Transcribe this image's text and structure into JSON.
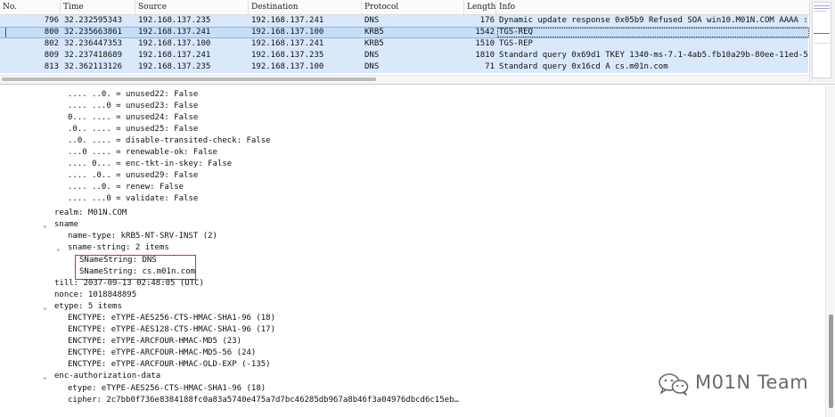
{
  "packet_list": {
    "columns": [
      "No.",
      "Time",
      "Source",
      "Destination",
      "Protocol",
      "Length",
      "Info"
    ],
    "rows": [
      {
        "no": "796",
        "time": "32.232595343",
        "source": "192.168.137.235",
        "destination": "192.168.137.241",
        "protocol": "DNS",
        "length": "176",
        "info": "Dynamic update response 0x05b9 Refused SOA win10.M01N.COM AAAA :: A"
      },
      {
        "no": "800",
        "time": "32.235663861",
        "source": "192.168.137.241",
        "destination": "192.168.137.100",
        "protocol": "KRB5",
        "length": "1542",
        "info": "TGS-REQ"
      },
      {
        "no": "802",
        "time": "32.236447353",
        "source": "192.168.137.100",
        "destination": "192.168.137.241",
        "protocol": "KRB5",
        "length": "1510",
        "info": "TGS-REP"
      },
      {
        "no": "809",
        "time": "32.237418689",
        "source": "192.168.137.241",
        "destination": "192.168.137.235",
        "protocol": "DNS",
        "length": "1810",
        "info": "Standard query 0x69d1 TKEY 1340-ms-7.1-4ab5.fb10a29b-80ee-11ed-5e81"
      },
      {
        "no": "813",
        "time": "32.362113126",
        "source": "192.168.137.235",
        "destination": "192.168.137.100",
        "protocol": "DNS",
        "length": "71",
        "info": "Standard query 0x16cd A cs.m01n.com"
      }
    ],
    "selected_row_no": "800"
  },
  "detail_tree": {
    "lines": [
      {
        "text": ".... ..0. = unused22: False",
        "indent": 4
      },
      {
        "text": ".... ...0 = unused23: False",
        "indent": 4
      },
      {
        "text": "0... .... = unused24: False",
        "indent": 4
      },
      {
        "text": ".0.. .... = unused25: False",
        "indent": 4
      },
      {
        "text": "..0. .... = disable-transited-check: False",
        "indent": 4
      },
      {
        "text": "...0 .... = renewable-ok: False",
        "indent": 4
      },
      {
        "text": ".... 0... = enc-tkt-in-skey: False",
        "indent": 4
      },
      {
        "text": ".... .0.. = unused29: False",
        "indent": 4
      },
      {
        "text": ".... ..0. = renew: False",
        "indent": 4
      },
      {
        "text": ".... ...0 = validate: False",
        "indent": 4
      },
      {
        "text": "realm: M01N.COM",
        "indent": 1
      },
      {
        "text": "sname",
        "indent": 1,
        "expanded": true
      },
      {
        "text": "name-type: kRB5-NT-SRV-INST (2)",
        "indent": 2
      },
      {
        "text": "sname-string: 2 items",
        "indent": 2,
        "expanded": true
      },
      {
        "text": "SNameString: DNS",
        "indent": 3
      },
      {
        "text": "SNameString: cs.m01n.com",
        "indent": 3
      },
      {
        "text": "till: 2037-09-13 02:48:05 (UTC)",
        "indent": 1
      },
      {
        "text": "nonce: 1018848895",
        "indent": 1
      },
      {
        "text": "etype: 5 items",
        "indent": 1,
        "expanded": true
      },
      {
        "text": "ENCTYPE: eTYPE-AES256-CTS-HMAC-SHA1-96 (18)",
        "indent": 2
      },
      {
        "text": "ENCTYPE: eTYPE-AES128-CTS-HMAC-SHA1-96 (17)",
        "indent": 2
      },
      {
        "text": "ENCTYPE: eTYPE-ARCFOUR-HMAC-MD5 (23)",
        "indent": 2
      },
      {
        "text": "ENCTYPE: eTYPE-ARCFOUR-HMAC-MD5-56 (24)",
        "indent": 2
      },
      {
        "text": "ENCTYPE: eTYPE-ARCFOUR-HMAC-OLD-EXP (-135)",
        "indent": 2
      },
      {
        "text": "enc-authorization-data",
        "indent": 1,
        "expanded": true
      },
      {
        "text": "etype: eTYPE-AES256-CTS-HMAC-SHA1-96 (18)",
        "indent": 2
      },
      {
        "text": "cipher: 2c7bb0f736e8384188fc0a83a5740e475a7d7bc46285db967a8b46f3a04976dbcd6c15eb…",
        "indent": 2
      }
    ]
  },
  "icons": {
    "expand": "chevron-down-icon",
    "watermark": "wechat-icon"
  },
  "colors": {
    "row_bg": "#dae8fb",
    "selected_row_bg": "#c7def8",
    "highlight_box": "#d32f2f"
  },
  "watermark": {
    "text": "M01N Team"
  }
}
